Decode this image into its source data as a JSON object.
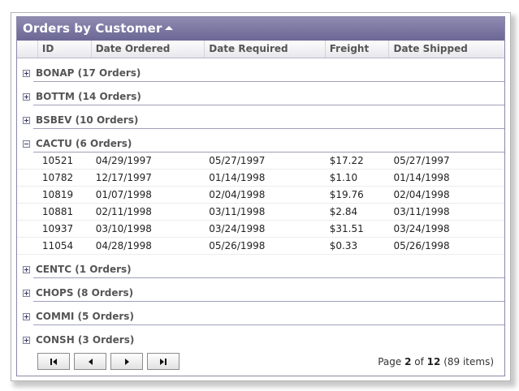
{
  "grid": {
    "title": "Orders by Customer",
    "columns": [
      "ID",
      "Date Ordered",
      "Date Required",
      "Freight",
      "Date Shipped"
    ],
    "groups_before": [
      {
        "label": "BONAP (17 Orders)"
      },
      {
        "label": "BOTTM (14 Orders)"
      },
      {
        "label": "BSBEV (10 Orders)"
      }
    ],
    "expanded_group": {
      "label": "CACTU (6 Orders)",
      "rows": [
        {
          "id": "10521",
          "ordered": "04/29/1997",
          "required": "05/27/1997",
          "freight": "$17.22",
          "shipped": "05/27/1997"
        },
        {
          "id": "10782",
          "ordered": "12/17/1997",
          "required": "01/14/1998",
          "freight": "$1.10",
          "shipped": "01/14/1998"
        },
        {
          "id": "10819",
          "ordered": "01/07/1998",
          "required": "02/04/1998",
          "freight": "$19.76",
          "shipped": "02/04/1998"
        },
        {
          "id": "10881",
          "ordered": "02/11/1998",
          "required": "03/11/1998",
          "freight": "$2.84",
          "shipped": "03/11/1998"
        },
        {
          "id": "10937",
          "ordered": "03/10/1998",
          "required": "03/24/1998",
          "freight": "$31.51",
          "shipped": "03/24/1998"
        },
        {
          "id": "11054",
          "ordered": "04/28/1998",
          "required": "05/26/1998",
          "freight": "$0.33",
          "shipped": "05/26/1998"
        }
      ]
    },
    "groups_after": [
      {
        "label": "CENTC (1 Orders)"
      },
      {
        "label": "CHOPS (8 Orders)"
      },
      {
        "label": "COMMI (5 Orders)"
      },
      {
        "label": "CONSH (3 Orders)"
      }
    ]
  },
  "pager": {
    "page_prefix": "Page ",
    "current_page": "2",
    "of_text": " of ",
    "total_pages": "12",
    "items_text": " (89 items)"
  },
  "colors": {
    "title_bar": "#7a76a2",
    "group_rule": "#9ea0b8"
  }
}
